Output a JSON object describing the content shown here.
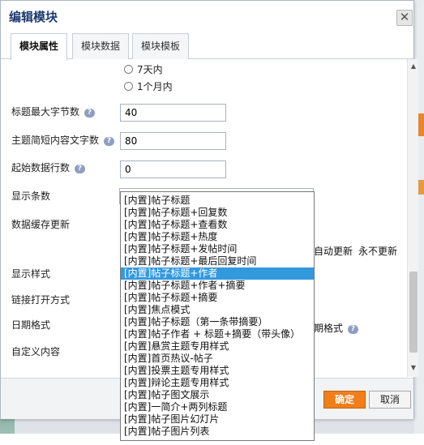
{
  "dialog": {
    "title": "编辑模块",
    "close_symbol": "✕"
  },
  "tabs": [
    {
      "label": "模块属性",
      "active": true
    },
    {
      "label": "模块数据",
      "active": false
    },
    {
      "label": "模块模板",
      "active": false
    }
  ],
  "form": {
    "radio_partial_label": "7天内",
    "radio_month_label": "1个月内",
    "title_max_bytes": {
      "label": "标题最大字节数",
      "value": "40"
    },
    "summary_max_chars": {
      "label": "主题简短内容文字数",
      "value": "80"
    },
    "start_row": {
      "label": "起始数据行数",
      "value": "0"
    },
    "display_count": {
      "label": "显示条数"
    },
    "cache_update": {
      "label": "数据缓存更新",
      "option_auto": "自动更新",
      "option_never": "永不更新"
    },
    "display_style": {
      "label": "显示样式"
    },
    "link_target": {
      "label": "链接打开方式"
    },
    "date_format": {
      "label": "日期格式",
      "trailing": "期格式"
    },
    "custom_content": {
      "label": "自定义内容"
    },
    "help_symbol": "?"
  },
  "dropdown_options": [
    "[内置]帖子标题",
    "[内置]帖子标题+回复数",
    "[内置]帖子标题+查看数",
    "[内置]帖子标题+热度",
    "[内置]帖子标题+发帖时间",
    "[内置]帖子标题+最后回复时间",
    "[内置]帖子标题+作者",
    "[内置]帖子标题+作者+摘要",
    "[内置]帖子标题+摘要",
    "[内置]焦点模式",
    "[内置]帖子标题（第一条带摘要）",
    "[内置]帖子作者 + 标题+摘要（带头像）",
    "[内置]悬赏主题专用样式",
    "[内置]首页热议-帖子",
    "[内置]投票主题专用样式",
    "[内置]辩论主题专用样式",
    "[内置]帖子图文展示",
    "[内置]一简介+两列标题",
    "[内置]帖子图片幻灯片",
    "[内置]帖子图片列表"
  ],
  "dropdown_selected_index": 6,
  "footer": {
    "ok_label": "确定",
    "cancel_label": "取消"
  },
  "colors": {
    "accent": "#f07e1a",
    "title": "#1d3a6e",
    "selection": "#3399dd"
  }
}
